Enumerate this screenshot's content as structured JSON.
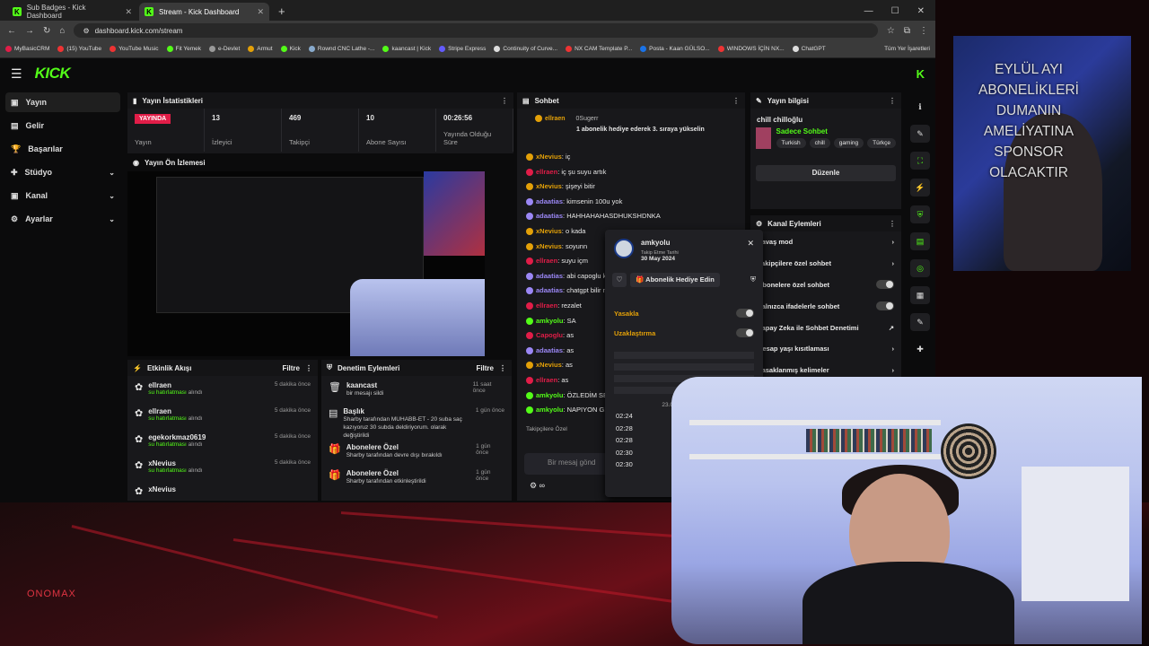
{
  "tabs": [
    {
      "label": "Sub Badges - Kick Dashboard",
      "active": false
    },
    {
      "label": "Stream - Kick Dashboard",
      "active": true
    }
  ],
  "address": "dashboard.kick.com/stream",
  "bookmarks": [
    "MyBasicCRM",
    "(15) YouTube",
    "YouTube Music",
    "Fit Yemek",
    "e-Devlet",
    "Armut",
    "Kick",
    "Rownd CNC Lathe -...",
    "kaancast | Kick",
    "Stripe Express",
    "Continuity of Curve...",
    "NX CAM Template P...",
    "Posta - Kaan GÜLSO...",
    "WINDOWS İÇİN NX...",
    "ChatGPT"
  ],
  "bookmarks_right": "Tüm Yer İşaretleri",
  "logo": "KICK",
  "nav": [
    {
      "label": "Yayın",
      "active": true
    },
    {
      "label": "Gelir"
    },
    {
      "label": "Başarılar"
    },
    {
      "label": "Stüdyo",
      "chev": true
    },
    {
      "label": "Kanal",
      "chev": true
    },
    {
      "label": "Ayarlar",
      "chev": true
    }
  ],
  "stats": {
    "title": "Yayın İstatistikleri",
    "live": "YAYINDA",
    "items": [
      {
        "v": "",
        "l": "Yayın"
      },
      {
        "v": "13",
        "l": "İzleyici"
      },
      {
        "v": "469",
        "l": "Takipçi"
      },
      {
        "v": "10",
        "l": "Abone Sayısı"
      },
      {
        "v": "00:26:56",
        "l": "Yayında Olduğu Süre"
      }
    ]
  },
  "preview_title": "Yayın Ön İzlemesi",
  "activity": {
    "title": "Etkinlik Akışı",
    "filter": "Filtre",
    "items": [
      {
        "n": "ellraen",
        "s": "su hatırlatması",
        "a": "alındı",
        "t": "5 dakika önce"
      },
      {
        "n": "ellraen",
        "s": "su hatırlatması",
        "a": "alındı",
        "t": "5 dakika önce"
      },
      {
        "n": "egekorkmaz0619",
        "s": "su hatırlatması",
        "a": "alındı",
        "t": "5 dakika önce"
      },
      {
        "n": "xNevius",
        "s": "su hatırlatması",
        "a": "alındı",
        "t": "5 dakika önce"
      },
      {
        "n": "xNevius",
        "s": "",
        "a": "",
        "t": ""
      }
    ]
  },
  "moderation": {
    "title": "Denetim Eylemleri",
    "filter": "Filtre",
    "items": [
      {
        "n": "kaancast",
        "d": "bir mesajı sildi",
        "t": "11 saat önce"
      },
      {
        "n": "Başlık",
        "d": "Sharby tarafından MUHABB-ET - 20 suba saç kazıyoruz 30 subda deldiriyorum. olarak değiştirildi",
        "t": "1 gün önce"
      },
      {
        "n": "Abonelere Özel",
        "d": "Sharby tarafından devre dışı bırakıldı",
        "t": "1 gün önce"
      },
      {
        "n": "Abonelere Özel",
        "d": "Sharby tarafından etkinleştirildi",
        "t": "1 gün önce"
      }
    ]
  },
  "chat": {
    "title": "Sohbet",
    "pinned_user": "ellraen",
    "pinned_other": "0Sugerr",
    "pinned_msg": "1 abonelik hediye ederek 3. sıraya yükselin",
    "input": "Bir mesaj gönd",
    "followers": "Takipçilere Özel",
    "messages": [
      {
        "u": "xNevius",
        "c": "#e3a008",
        "m": "iç"
      },
      {
        "u": "ellraen",
        "c": "#e11d48",
        "m": "iç şu suyu artık"
      },
      {
        "u": "xNevius",
        "c": "#e3a008",
        "m": "şişeyi bitir"
      },
      {
        "u": "adaatias",
        "c": "#9b87f5",
        "m": "kimsenin 100u yok"
      },
      {
        "u": "adaatias",
        "c": "#9b87f5",
        "m": "HAHHAHAHASDHUKSHDNKA"
      },
      {
        "u": "xNevius",
        "c": "#e3a008",
        "m": "o kada"
      },
      {
        "u": "xNevius",
        "c": "#e3a008",
        "m": "soyunn"
      },
      {
        "u": "ellraen",
        "c": "#e11d48",
        "m": "suyu içm"
      },
      {
        "u": "adaatias",
        "c": "#9b87f5",
        "m": "abi capoglu ki"
      },
      {
        "u": "adaatias",
        "c": "#9b87f5",
        "m": "chatgpt bilir m"
      },
      {
        "u": "ellraen",
        "c": "#e11d48",
        "m": "rezalet"
      },
      {
        "u": "amkyolu",
        "c": "#53fc18",
        "m": "SA"
      },
      {
        "u": "Capoglu",
        "c": "#e11d48",
        "m": "as"
      },
      {
        "u": "adaatias",
        "c": "#9b87f5",
        "m": "as"
      },
      {
        "u": "xNevius",
        "c": "#e3a008",
        "m": "as"
      },
      {
        "u": "ellraen",
        "c": "#e11d48",
        "m": "as"
      },
      {
        "u": "amkyolu",
        "c": "#53fc18",
        "m": "ÖZLEDİM SEN"
      },
      {
        "u": "amkyolu",
        "c": "#53fc18",
        "m": "NAPIYON G."
      }
    ]
  },
  "popup": {
    "user": "amkyolu",
    "follow_label": "Takip Etme Tarihi",
    "follow_date": "30 May 2024",
    "gift": "Abonelik Hediye Edin",
    "ban": "Yasakla",
    "timeout": "Uzaklaştırma",
    "date_sep": "23.0",
    "times": [
      "02:24",
      "02:28",
      "02:28",
      "02:30",
      "02:30"
    ]
  },
  "info": {
    "title": "Yayın bilgisi",
    "stream_title": "chill chilloğlu",
    "category": "Sadece Sohbet",
    "tags": [
      "Turkish",
      "chill",
      "gaming",
      "Türkçe"
    ],
    "edit": "Düzenle"
  },
  "channel": {
    "title": "Kanal Eylemleri",
    "items": [
      {
        "l": "Yavaş mod",
        "k": "chev"
      },
      {
        "l": "Takipçilere özel sohbet",
        "k": "chev"
      },
      {
        "l": "Abonelere özel sohbet",
        "k": "toggle"
      },
      {
        "l": "Yalnızca ifadelerle sohbet",
        "k": "toggle"
      },
      {
        "l": "Yapay Zeka ile Sohbet Denetimi",
        "k": "ext"
      },
      {
        "l": "Hesap yaşı kısıtlaması",
        "k": "chev"
      },
      {
        "l": "Yasaklanmış kelimeler",
        "k": "chev"
      }
    ]
  },
  "overlay": "EYLÜL AYI ABONELİKLERİ DUMANIN AMELİYATINA SPONSOR OLACAKTIR",
  "watermark": "ONOMAX"
}
